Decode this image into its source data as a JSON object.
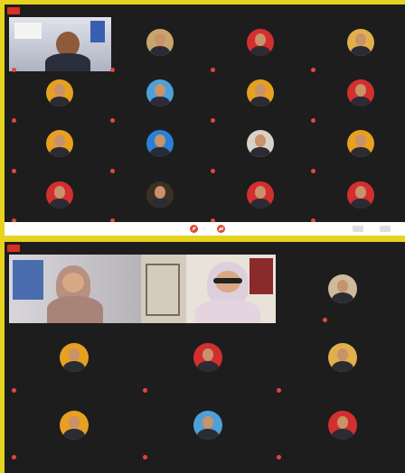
{
  "screen1": {
    "record_badge": "REC",
    "meeting_title": "",
    "self_label": "",
    "participants": [
      {
        "label": "",
        "color": "#c9a56a"
      },
      {
        "label": "",
        "color": "#d32f2f"
      },
      {
        "label": "",
        "color": "#e2b04a"
      },
      {
        "label": "",
        "color": "#e8a020"
      },
      {
        "label": "",
        "color": "#4ea0d8"
      },
      {
        "label": "",
        "color": "#e8a020"
      },
      {
        "label": "",
        "color": "#d32f2f"
      },
      {
        "label": "",
        "color": "#e8a020"
      },
      {
        "label": "",
        "color": "#2c7fd8"
      },
      {
        "label": "",
        "color": "#d8d2c8"
      },
      {
        "label": "",
        "color": "#e8a020"
      },
      {
        "label": "",
        "color": "#d32f2f"
      },
      {
        "label": "",
        "color": "#3a3026"
      },
      {
        "label": "",
        "color": "#d32f2f"
      },
      {
        "label": "",
        "color": "#d32f2f"
      }
    ]
  },
  "screen2": {
    "record_badge": "REC",
    "participants": [
      {
        "label": "",
        "color": "#cdbb9b"
      },
      {
        "label": "",
        "color": "#e8a020"
      },
      {
        "label": "",
        "color": "#d32f2f"
      },
      {
        "label": "",
        "color": "#e2b04a"
      },
      {
        "label": "",
        "color": "#e8a020"
      },
      {
        "label": "",
        "color": "#4ea0d8"
      },
      {
        "label": "",
        "color": "#d32f2f"
      }
    ]
  }
}
